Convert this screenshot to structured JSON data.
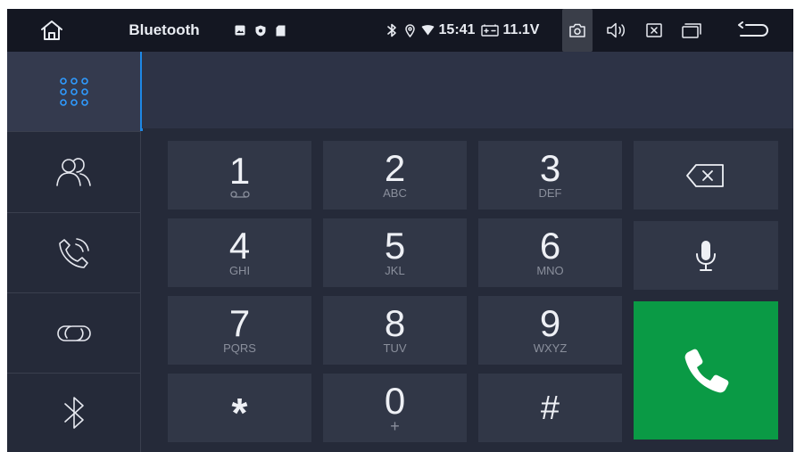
{
  "statusbar": {
    "title": "Bluetooth",
    "time": "15:41",
    "voltage": "11.1V",
    "icons": [
      "home-icon",
      "gallery-icon",
      "shield-icon",
      "sd-card-icon",
      "bluetooth-icon",
      "location-icon",
      "wifi-icon",
      "battery-icon",
      "camera-icon",
      "volume-icon",
      "close-app-icon",
      "recent-apps-icon",
      "back-icon"
    ]
  },
  "sidebar": {
    "items": [
      {
        "name": "dialpad",
        "icon": "dialpad-icon",
        "active": true
      },
      {
        "name": "contacts",
        "icon": "contacts-icon",
        "active": false
      },
      {
        "name": "call-log",
        "icon": "phone-call-icon",
        "active": false
      },
      {
        "name": "device-link",
        "icon": "link-icon",
        "active": false
      },
      {
        "name": "bluetooth-settings",
        "icon": "bluetooth-icon",
        "active": false
      }
    ]
  },
  "display": {
    "number": ""
  },
  "keypad": {
    "keys": [
      {
        "digit": "1",
        "letters": ""
      },
      {
        "digit": "2",
        "letters": "ABC"
      },
      {
        "digit": "3",
        "letters": "DEF"
      },
      {
        "digit": "4",
        "letters": "GHI"
      },
      {
        "digit": "5",
        "letters": "JKL"
      },
      {
        "digit": "6",
        "letters": "MNO"
      },
      {
        "digit": "7",
        "letters": "PQRS"
      },
      {
        "digit": "8",
        "letters": "TUV"
      },
      {
        "digit": "9",
        "letters": "WXYZ"
      },
      {
        "digit": "*",
        "letters": ""
      },
      {
        "digit": "0",
        "letters": "+"
      },
      {
        "digit": "#",
        "letters": ""
      }
    ]
  },
  "actions": {
    "backspace_icon": "backspace-icon",
    "mic_icon": "microphone-icon",
    "call_icon": "phone-handset-icon",
    "call_color": "#0a9a45",
    "accent_color": "#1e88e5"
  }
}
